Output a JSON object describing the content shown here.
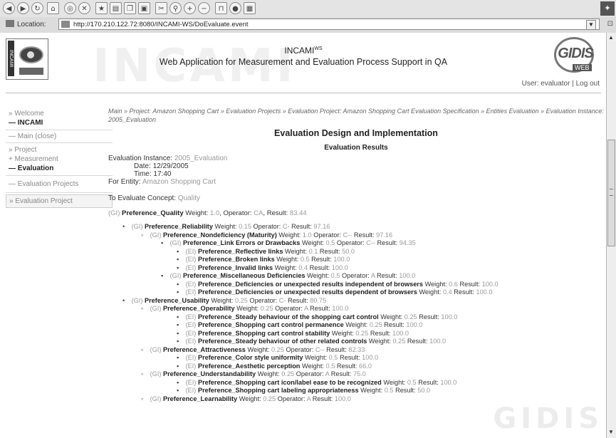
{
  "browser": {
    "location_label": "Location:",
    "url": "http://170.210.122.72:8080/INCAMI-WS/DoEvaluate.event",
    "toolbar_icons": [
      "back-icon",
      "forward-icon",
      "reload-icon",
      "home-icon",
      "search-icon",
      "stop-icon",
      "bookmark-icon",
      "print-icon",
      "copy-icon",
      "paste-icon",
      "cut-icon",
      "find-icon",
      "zoom-in-icon",
      "zoom-out-icon",
      "lock-icon",
      "globe-icon",
      "grid-icon"
    ]
  },
  "header": {
    "logo_text": "INCAMI",
    "title": "INCAMI",
    "title_sup": "WS",
    "subtitle": "Web Application for Measurement and Evaluation Process Support in QA",
    "gidis_logo": "GIDIS",
    "gidis_web": "WEB",
    "user_label": "User: evaluator",
    "separator": "|",
    "logout": "Log out",
    "watermark": "INCAMI"
  },
  "nav": {
    "welcome": "» Welcome",
    "incami": "— INCAMI",
    "main": "— Main (close)",
    "project": "» Project",
    "measurement": "+ Measurement",
    "evaluation": "— Evaluation",
    "evaluation_projects": "— Evaluation Projects",
    "evaluation_project": "» Evaluation Project"
  },
  "breadcrumb": {
    "text": "Main » Project: Amazon Shopping Cart » Evaluation Projects » Evaluation Project: Amazon Shopping Cart Evaluation Specification » Entities Evaluation » Evaluation Instance: 2005_Evaluation"
  },
  "page": {
    "title": "Evaluation Design and Implementation",
    "results_heading": "Evaluation Results",
    "instance_label": "Evaluation Instance:",
    "instance_value": "2005_Evaluation",
    "date_label": "Date:",
    "date_value": "12/29/2005",
    "time_label": "Time:",
    "time_value": "17:40",
    "entity_label": "For Entity:",
    "entity_value": "Amazon Shopping Cart",
    "concept_label": "To Evaluate Concept:",
    "concept_value": "Quality",
    "root": {
      "tag": "(GI)",
      "name": "Preference_Quality",
      "w_label": "Weight:",
      "weight": "1.0",
      "op_label": "Operator:",
      "operator": "CA",
      "r_label": "Result:",
      "result": "83.44"
    }
  },
  "tree": [
    {
      "mark": "•",
      "tag": "(GI)",
      "name": "Preference_Reliability",
      "weight": "0.15",
      "operator": "C-",
      "result": "97.16"
    },
    {
      "mark": "◦",
      "tag": "(GI)",
      "name": "Preference_Nondeficiency (Maturity)",
      "weight": "1.0",
      "operator": "C--",
      "result": "97.16"
    },
    {
      "mark": "▪",
      "tag": "(GI)",
      "name": "Preference_Link Errors or Drawbacks",
      "weight": "0.5",
      "operator": "C--",
      "result": "94.35"
    },
    {
      "mark": "▪",
      "tag": "(EI)",
      "name": "Preference_Reflective links",
      "weight": "0.1",
      "result": "50.0"
    },
    {
      "mark": "▪",
      "tag": "(EI)",
      "name": "Preference_Broken links",
      "weight": "0.5",
      "result": "100.0"
    },
    {
      "mark": "▪",
      "tag": "(EI)",
      "name": "Preference_Invalid links",
      "weight": "0.4",
      "result": "100.0"
    },
    {
      "mark": "▪",
      "tag": "(GI)",
      "name": "Preference_Miscellaneous Deficiencies",
      "weight": "0.5",
      "operator": "A",
      "result": "100.0"
    },
    {
      "mark": "▪",
      "tag": "(EI)",
      "name": "Preference_Deficiencies or unexpected results independent of browsers",
      "weight": "0.6",
      "result": "100.0"
    },
    {
      "mark": "▪",
      "tag": "(EI)",
      "name": "Preference_Deficiencies or unexpected results dependent of browsers",
      "weight": "0.4",
      "result": "100.0"
    },
    {
      "mark": "•",
      "tag": "(GI)",
      "name": "Preference_Usability",
      "weight": "0.25",
      "operator": "C-",
      "result": "80.75"
    },
    {
      "mark": "◦",
      "tag": "(GI)",
      "name": "Preference_Operability",
      "weight": "0.25",
      "operator": "A",
      "result": "100.0"
    },
    {
      "mark": "▪",
      "tag": "(EI)",
      "name": "Preference_Steady behaviour of the shopping cart control",
      "weight": "0.25",
      "result": "100.0"
    },
    {
      "mark": "▪",
      "tag": "(EI)",
      "name": "Preference_Shopping cart control permanence",
      "weight": "0.25",
      "result": "100.0"
    },
    {
      "mark": "▪",
      "tag": "(EI)",
      "name": "Preference_Shopping cart control stability",
      "weight": "0.25",
      "result": "100.0"
    },
    {
      "mark": "▪",
      "tag": "(EI)",
      "name": "Preference_Steady behaviour of other related controls",
      "weight": "0.25",
      "result": "100.0"
    },
    {
      "mark": "◦",
      "tag": "(GI)",
      "name": "Preference_Attractiveness",
      "weight": "0.25",
      "operator": "C--",
      "result": "82.33"
    },
    {
      "mark": "▪",
      "tag": "(EI)",
      "name": "Preference_Color style uniformity",
      "weight": "0.5",
      "result": "100.0"
    },
    {
      "mark": "▪",
      "tag": "(EI)",
      "name": "Preference_Aesthetic perception",
      "weight": "0.5",
      "result": "66.0"
    },
    {
      "mark": "◦",
      "tag": "(GI)",
      "name": "Preference_Understandability",
      "weight": "0.25",
      "operator": "A",
      "result": "75.0"
    },
    {
      "mark": "▪",
      "tag": "(EI)",
      "name": "Preference_Shopping cart icon/label ease to be recognized",
      "weight": "0.5",
      "result": "100.0"
    },
    {
      "mark": "▪",
      "tag": "(EI)",
      "name": "Preference_Shopping cart labeling appropriateness",
      "weight": "0.5",
      "result": "50.0"
    },
    {
      "mark": "◦",
      "tag": "(GI)",
      "name": "Preference_Learnability",
      "weight": "0.25",
      "operator": "A",
      "result": "100.0"
    }
  ],
  "labels": {
    "weight": "Weight:",
    "operator": "Operator:",
    "result": "Result:"
  },
  "watermark_bottom": "GIDIS"
}
